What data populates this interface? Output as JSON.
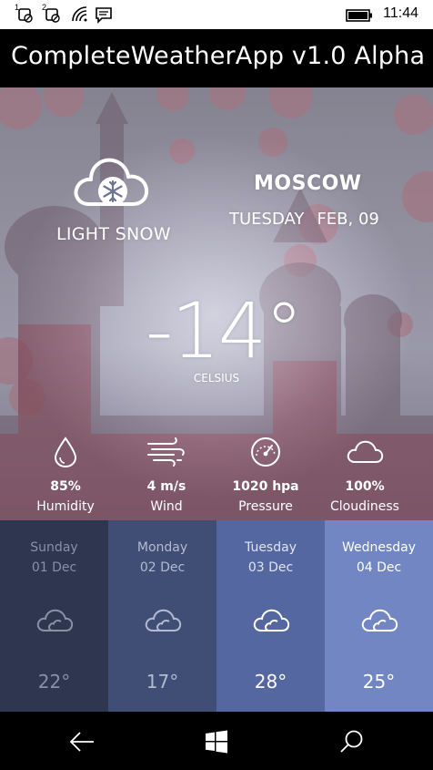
{
  "status_bar": {
    "sim1": "1",
    "sim2": "2",
    "time": "11:44"
  },
  "app": {
    "title": "CompleteWeatherApp v1.0 Alpha"
  },
  "current": {
    "city": "MOSCOW",
    "day": "TUESDAY",
    "date": "FEB, 09",
    "condition": "LIGHT SNOW",
    "temperature": "-14°",
    "unit": "CELSIUS",
    "icon": "snow-cloud-icon"
  },
  "stats": [
    {
      "icon": "humidity-drop-icon",
      "value": "85%",
      "label": "Humidity"
    },
    {
      "icon": "wind-icon",
      "value": "4 m/s",
      "label": "Wind"
    },
    {
      "icon": "pressure-gauge-icon",
      "value": "1020 hpa",
      "label": "Pressure"
    },
    {
      "icon": "cloud-icon",
      "value": "100%",
      "label": "Cloudiness"
    }
  ],
  "forecast": [
    {
      "day": "Sunday",
      "date": "01 Dec",
      "temp": "22°",
      "icon": "cloud-icon",
      "color": "#2e3650"
    },
    {
      "day": "Monday",
      "date": "02 Dec",
      "temp": "17°",
      "icon": "cloud-icon",
      "color": "#404d74"
    },
    {
      "day": "Tuesday",
      "date": "03 Dec",
      "temp": "28°",
      "icon": "cloud-icon",
      "color": "#5567a0"
    },
    {
      "day": "Wednesday",
      "date": "04 Dec",
      "temp": "25°",
      "icon": "cloud-icon",
      "color": "#7186c2"
    }
  ],
  "nav": {
    "back_icon": "back-arrow-icon",
    "home_icon": "windows-logo-icon",
    "search_icon": "search-icon"
  }
}
